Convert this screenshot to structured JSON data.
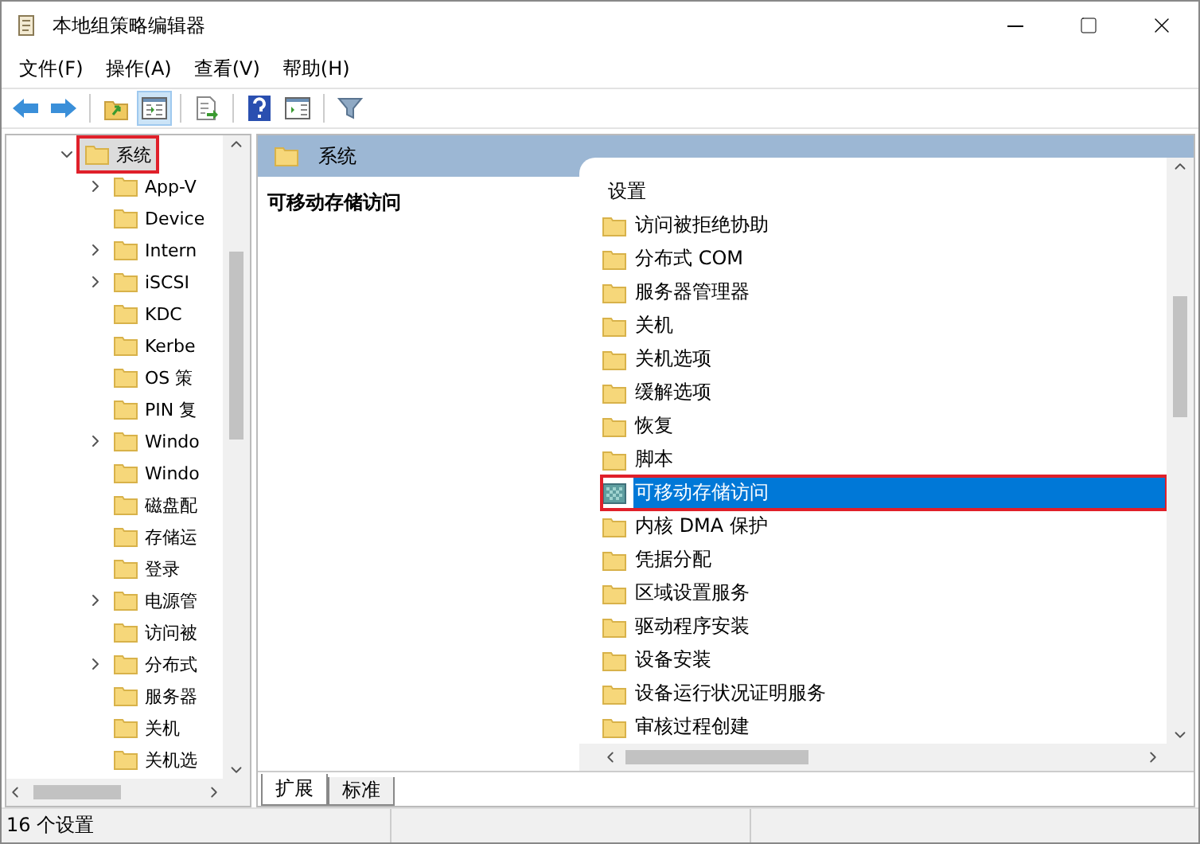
{
  "window": {
    "title": "本地组策略编辑器"
  },
  "menu": [
    "文件(F)",
    "操作(A)",
    "查看(V)",
    "帮助(H)"
  ],
  "toolbar": [
    {
      "kind": "back",
      "pressed": false
    },
    {
      "kind": "forward",
      "pressed": false
    },
    {
      "kind": "sep"
    },
    {
      "kind": "up",
      "pressed": false
    },
    {
      "kind": "tree",
      "pressed": true
    },
    {
      "kind": "sep"
    },
    {
      "kind": "export",
      "pressed": false
    },
    {
      "kind": "sep"
    },
    {
      "kind": "help",
      "pressed": false
    },
    {
      "kind": "pane",
      "pressed": false
    },
    {
      "kind": "sep"
    },
    {
      "kind": "filter",
      "pressed": false
    }
  ],
  "tree": [
    {
      "label": "系统",
      "expanded": true,
      "selected": false,
      "highlighted": true,
      "children": [
        {
          "label": "App-V",
          "expandable": true
        },
        {
          "label": "Device",
          "expandable": false
        },
        {
          "label": "Intern",
          "expandable": true
        },
        {
          "label": "iSCSI",
          "expandable": true
        },
        {
          "label": "KDC",
          "expandable": false
        },
        {
          "label": "Kerbe",
          "expandable": false
        },
        {
          "label": "OS 策",
          "expandable": false
        },
        {
          "label": "PIN 复",
          "expandable": false
        },
        {
          "label": "Windo",
          "expandable": true
        },
        {
          "label": "Windo",
          "expandable": false
        },
        {
          "label": "磁盘配",
          "expandable": false
        },
        {
          "label": "存储运",
          "expandable": false
        },
        {
          "label": "登录",
          "expandable": false
        },
        {
          "label": "电源管",
          "expandable": true
        },
        {
          "label": "访问被",
          "expandable": false
        },
        {
          "label": "分布式",
          "expandable": true
        },
        {
          "label": "服务器",
          "expandable": false
        },
        {
          "label": "关机",
          "expandable": false
        },
        {
          "label": "关机选",
          "expandable": false
        }
      ]
    }
  ],
  "header": {
    "title": "系统"
  },
  "description": {
    "title": "可移动存储访问"
  },
  "settings": {
    "column": "设置",
    "items": [
      {
        "label": "访问被拒绝协助",
        "selected": false,
        "highlighted": false
      },
      {
        "label": "分布式 COM",
        "selected": false,
        "highlighted": false
      },
      {
        "label": "服务器管理器",
        "selected": false,
        "highlighted": false
      },
      {
        "label": "关机",
        "selected": false,
        "highlighted": false
      },
      {
        "label": "关机选项",
        "selected": false,
        "highlighted": false
      },
      {
        "label": "缓解选项",
        "selected": false,
        "highlighted": false
      },
      {
        "label": "恢复",
        "selected": false,
        "highlighted": false
      },
      {
        "label": "脚本",
        "selected": false,
        "highlighted": false
      },
      {
        "label": "可移动存储访问",
        "selected": true,
        "highlighted": true
      },
      {
        "label": "内核 DMA 保护",
        "selected": false,
        "highlighted": false
      },
      {
        "label": "凭据分配",
        "selected": false,
        "highlighted": false
      },
      {
        "label": "区域设置服务",
        "selected": false,
        "highlighted": false
      },
      {
        "label": "驱动程序安装",
        "selected": false,
        "highlighted": false
      },
      {
        "label": "设备安装",
        "selected": false,
        "highlighted": false
      },
      {
        "label": "设备运行状况证明服务",
        "selected": false,
        "highlighted": false
      },
      {
        "label": "审核过程创建",
        "selected": false,
        "highlighted": false
      }
    ]
  },
  "tabs": [
    {
      "label": "扩展",
      "selected": true
    },
    {
      "label": "标准",
      "selected": false
    }
  ],
  "status_bar": {
    "text": "16 个设置"
  }
}
